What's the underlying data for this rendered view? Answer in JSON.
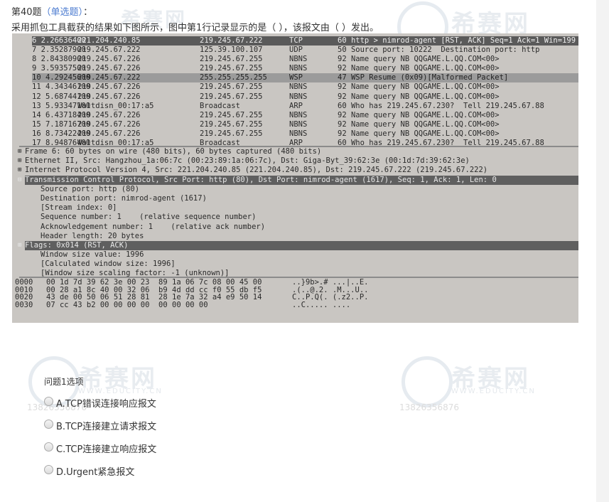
{
  "question": {
    "number_label": "第40题",
    "type_label": "（单选题）",
    "suffix": "：",
    "text": "采用抓包工具截获的结果如下图所示，图中第1行记录显示的是（ ），该报文由（ ）发出。"
  },
  "watermark": {
    "brand": "希赛网",
    "url": "WWW.EDUCITY.CN",
    "phone": "13826356876"
  },
  "capture": {
    "packets": [
      {
        "no": "6",
        "time": "2.26636400",
        "src": "221.204.240.85",
        "dst": "219.245.67.222",
        "proto": "TCP",
        "info": "60 http > nimrod-agent [RST, ACK] Seq=1 Ack=1 Win=199"
      },
      {
        "no": "7",
        "time": "2.35287900",
        "src": "219.245.67.222",
        "dst": "125.39.100.107",
        "proto": "UDP",
        "info": "50 Source port: 10222  Destination port: http"
      },
      {
        "no": "8",
        "time": "2.84380900",
        "src": "219.245.67.226",
        "dst": "219.245.67.255",
        "proto": "NBNS",
        "info": "92 Name query NB QQGAME.L.QQ.COM<00>"
      },
      {
        "no": "9",
        "time": "3.59357500",
        "src": "219.245.67.226",
        "dst": "219.245.67.255",
        "proto": "NBNS",
        "info": "92 Name query NB QQGAME.L.QQ.COM<00>"
      },
      {
        "no": "10",
        "time": "4.29245600",
        "src": "219.245.67.222",
        "dst": "255.255.255.255",
        "proto": "WSP",
        "info": "47 WSP Resume (0x09)[Malformed Packet]"
      },
      {
        "no": "11",
        "time": "4.34346100",
        "src": "219.245.67.226",
        "dst": "219.245.67.255",
        "proto": "NBNS",
        "info": "92 Name query NB QQGAME.L.QQ.COM<00>"
      },
      {
        "no": "12",
        "time": "5.68744100",
        "src": "219.245.67.226",
        "dst": "219.245.67.255",
        "proto": "NBNS",
        "info": "92 Name query NB QQGAME.L.QQ.COM<00>"
      },
      {
        "no": "13",
        "time": "5.93347100",
        "src": "Waltdisn_00:17:a5",
        "dst": "Broadcast",
        "proto": "ARP",
        "info": "60 Who has 219.245.67.230?  Tell 219.245.67.88"
      },
      {
        "no": "14",
        "time": "6.43718400",
        "src": "219.245.67.226",
        "dst": "219.245.67.255",
        "proto": "NBNS",
        "info": "92 Name query NB QQGAME.L.QQ.COM<00>"
      },
      {
        "no": "15",
        "time": "7.18716700",
        "src": "219.245.67.226",
        "dst": "219.245.67.255",
        "proto": "NBNS",
        "info": "92 Name query NB QQGAME.L.QQ.COM<00>"
      },
      {
        "no": "16",
        "time": "8.73422400",
        "src": "219.245.67.226",
        "dst": "219.245.67.255",
        "proto": "NBNS",
        "info": "92 Name query NB QQGAME.L.QQ.COM<00>"
      },
      {
        "no": "17",
        "time": "8.94876400",
        "src": "Waltdisn_00:17:a5",
        "dst": "Broadcast",
        "proto": "ARP",
        "info": "60 Who has 219.245.67.230?  Tell 219.245.67.88"
      }
    ],
    "details": [
      {
        "text": "Frame 6: 60 bytes on wire (480 bits), 60 bytes captured (480 bits)",
        "tw": "⊞"
      },
      {
        "text": "Ethernet II, Src: Hangzhou_1a:06:7c (00:23:89:1a:06:7c), Dst: Giga-Byt_39:62:3e (00:1d:7d:39:62:3e)",
        "tw": "⊞"
      },
      {
        "text": "Internet Protocol Version 4, Src: 221.204.240.85 (221.204.240.85), Dst: 219.245.67.222 (219.245.67.222)",
        "tw": "⊞"
      },
      {
        "text": "Transmission Control Protocol, Src Port: http (80), Dst Port: nimrod-agent (1617), Seq: 1, Ack: 1, Len: 0",
        "tw": "⊟"
      },
      {
        "text": "Source port: http (80)"
      },
      {
        "text": "Destination port: nimrod-agent (1617)"
      },
      {
        "text": "[Stream index: 0]"
      },
      {
        "text": "Sequence number: 1    (relative sequence number)"
      },
      {
        "text": "Acknowledgement number: 1    (relative ack number)"
      },
      {
        "text": "Header length: 20 bytes"
      },
      {
        "text": "Flags: 0x014 (RST, ACK)",
        "tw": "⊞"
      },
      {
        "text": "Window size value: 1996"
      },
      {
        "text": "[Calculated window size: 1996]"
      },
      {
        "text": "[Window size scaling factor: -1 (unknown)]"
      }
    ],
    "hex": [
      {
        "off": "0000",
        "bytes": "00 1d 7d 39 62 3e 00 23  89 1a 06 7c 08 00 45 00",
        "ascii": "..}9b>.# ...|..E."
      },
      {
        "off": "0010",
        "bytes": "00 28 a1 8c 40 00 32 06  b9 4d dd cc f0 55 db f5",
        "ascii": ".(..@.2. .M...U.."
      },
      {
        "off": "0020",
        "bytes": "43 de 00 50 06 51 28 81  28 1e 7a 32 a4 e9 50 14",
        "ascii": "C..P.Q(. (.z2..P."
      },
      {
        "off": "0030",
        "bytes": "07 cc 43 b2 00 00 00 00  00 00 00 00",
        "ascii": "..C..... ...."
      }
    ]
  },
  "options": {
    "title": "问题1选项",
    "items": [
      {
        "letter": "A",
        "label": "A.TCP错误连接响应报文"
      },
      {
        "letter": "B",
        "label": "B.TCP连接建立请求报文"
      },
      {
        "letter": "C",
        "label": "C.TCP连接建立响应报文"
      },
      {
        "letter": "D",
        "label": "D.Urgent紧急报文"
      }
    ]
  }
}
